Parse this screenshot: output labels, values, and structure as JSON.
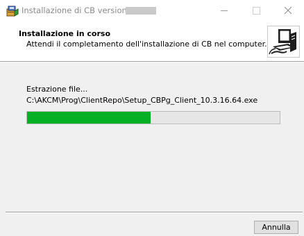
{
  "window": {
    "title": "Installazione di CB versione 10."
  },
  "header": {
    "title": "Installazione in corso",
    "subtitle": "Attendi il completamento dell'installazione di CB nel computer."
  },
  "status": {
    "label": "Estrazione file...",
    "path": "C:\\AKCM\\Prog\\ClientRepo\\Setup_CBPg_Client_10.3.16.64.exe"
  },
  "progress": {
    "percent": 49
  },
  "buttons": {
    "cancel": "Annulla"
  },
  "colors": {
    "progress_fill": "#06b025",
    "progress_track": "#e6e6e6"
  },
  "icons": {
    "app": "installer-package-icon",
    "header": "computer-setup-icon"
  }
}
